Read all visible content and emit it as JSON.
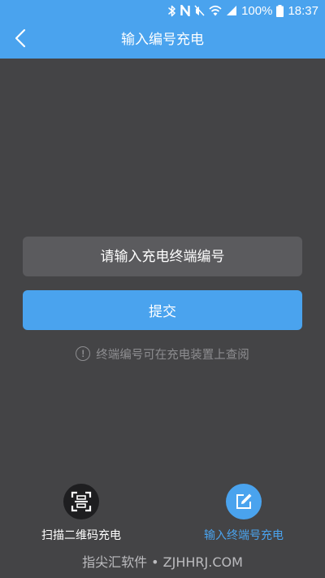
{
  "status_bar": {
    "icons": [
      "bluetooth-icon",
      "nfc-icon",
      "mute-icon",
      "wifi-icon",
      "cellular-signal-icon",
      "battery-icon"
    ],
    "battery": "100%",
    "time": "18:37"
  },
  "header": {
    "back_icon": "chevron-left-icon",
    "title": "输入编号充电"
  },
  "form": {
    "terminal_input": {
      "placeholder": "请输入充电终端编号",
      "value": ""
    },
    "submit_label": "提交",
    "hint_icon": "info-circle-icon",
    "hint": "终端编号可在充电装置上查阅"
  },
  "bottom_nav": {
    "items": [
      {
        "label": "扫描二维码充电",
        "icon": "qr-scan-icon",
        "active": false
      },
      {
        "label": "输入终端号充电",
        "icon": "edit-icon",
        "active": true
      }
    ]
  },
  "watermark": "指尖汇软件 • ZJHHRJ.COM",
  "colors": {
    "accent": "#4aa3ee",
    "background": "#444446",
    "input_background": "#5b5b5e",
    "hint_text": "#8d8d90",
    "scan_icon_background": "#1e1e20"
  }
}
